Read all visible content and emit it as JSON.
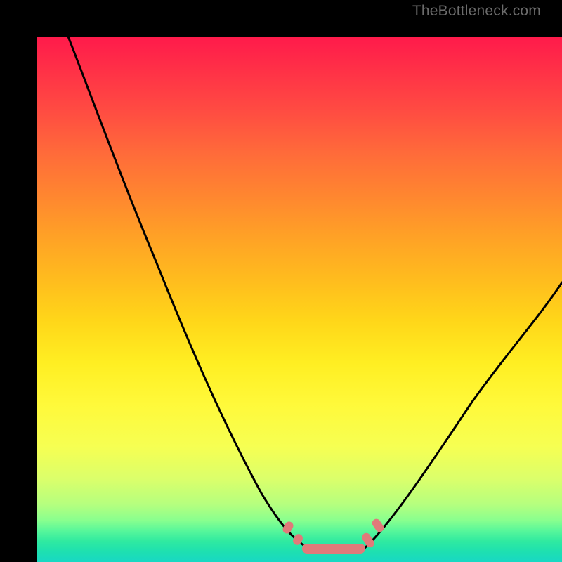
{
  "watermark": {
    "text": "TheBottleneck.com"
  },
  "colors": {
    "frame": "#000000",
    "curve": "#000000",
    "marker": "#e07a7a"
  },
  "chart_data": {
    "type": "line",
    "title": "",
    "xlabel": "",
    "ylabel": "",
    "xlim": [
      0,
      100
    ],
    "ylim": [
      0,
      100
    ],
    "grid": false,
    "series": [
      {
        "name": "left-curve",
        "x": [
          6,
          10,
          15,
          20,
          25,
          30,
          35,
          40,
          45,
          48,
          50,
          52
        ],
        "y": [
          100,
          87,
          75,
          64,
          53,
          43,
          33,
          23,
          13,
          7,
          4,
          2
        ]
      },
      {
        "name": "right-curve",
        "x": [
          62,
          65,
          70,
          75,
          80,
          85,
          90,
          95,
          100
        ],
        "y": [
          2,
          6,
          14,
          22,
          30,
          37,
          43,
          49,
          54
        ]
      },
      {
        "name": "flat-bottom",
        "x": [
          52,
          55,
          58,
          62
        ],
        "y": [
          2,
          1.5,
          1.5,
          2
        ]
      }
    ],
    "markers": {
      "name": "highlight-band",
      "x_range": [
        49,
        63
      ],
      "y": 2,
      "note": "rounded pink segment marking optimal zone"
    },
    "gradient_stops_pct_to_color": {
      "0": "#ff1a4b",
      "50": "#ffd619",
      "78": "#dcff6a",
      "100": "#18d8c4"
    }
  }
}
